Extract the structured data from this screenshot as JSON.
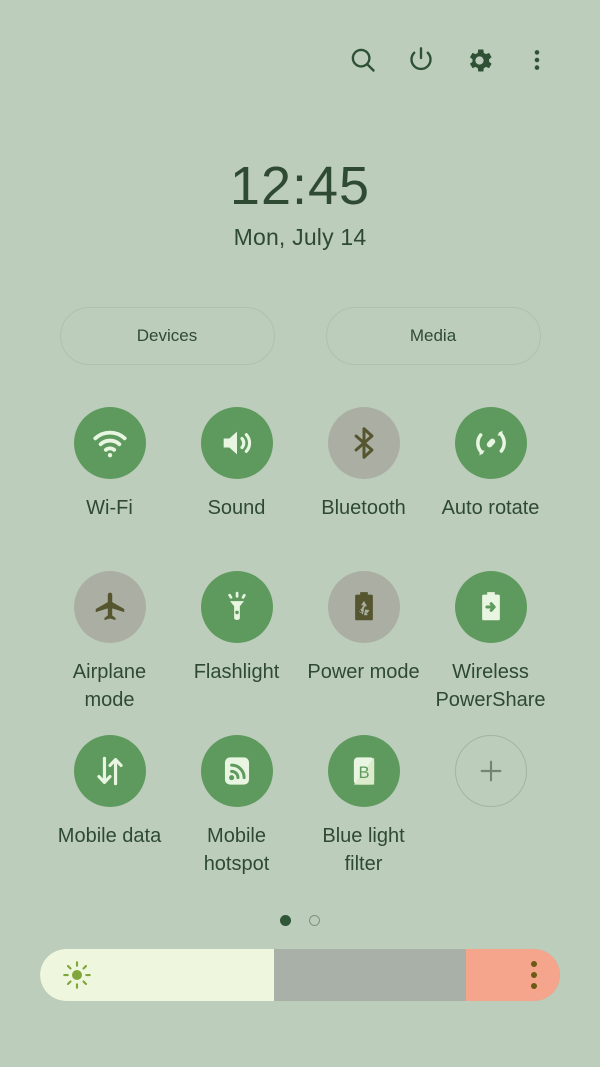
{
  "statusbar": {
    "icons": [
      {
        "name": "search-icon",
        "label": "Search"
      },
      {
        "name": "power-icon",
        "label": "Power off"
      },
      {
        "name": "gear-icon",
        "label": "Settings"
      },
      {
        "name": "more-options-icon",
        "label": "More options"
      }
    ]
  },
  "clock": {
    "time": "12:45",
    "date": "Mon, July 14"
  },
  "chips": [
    {
      "label": "Devices"
    },
    {
      "label": "Media"
    }
  ],
  "toggles": [
    {
      "label": "Wi-Fi",
      "icon": "wifi-icon",
      "state": "on"
    },
    {
      "label": "Sound",
      "icon": "sound-icon",
      "state": "on"
    },
    {
      "label": "Bluetooth",
      "icon": "bluetooth-icon",
      "state": "off"
    },
    {
      "label": "Auto rotate",
      "icon": "auto-rotate-icon",
      "state": "on"
    },
    {
      "label": "Airplane mode",
      "icon": "airplane-icon",
      "state": "off"
    },
    {
      "label": "Flashlight",
      "icon": "flashlight-icon",
      "state": "on"
    },
    {
      "label": "Power mode",
      "icon": "power-mode-icon",
      "state": "off"
    },
    {
      "label": "Wireless PowerShare",
      "icon": "wireless-powershare-icon",
      "state": "on"
    },
    {
      "label": "Mobile data",
      "icon": "mobile-data-icon",
      "state": "on"
    },
    {
      "label": "Mobile hotspot",
      "icon": "mobile-hotspot-icon",
      "state": "on"
    },
    {
      "label": "Blue light filter",
      "icon": "blue-light-filter-icon",
      "state": "on"
    },
    {
      "label": "",
      "icon": "add-icon",
      "state": "add"
    }
  ],
  "pager": {
    "pages": 2,
    "current": 1
  },
  "brightness": {
    "icon": "brightness-sun-icon",
    "value_percent": 45,
    "menu_icon": "brightness-more-icon"
  },
  "colors": {
    "background": "#BDCDBC",
    "accent_on": "#5E9A5E",
    "icon_on": "#E8F5E0",
    "inactive": "#ABAFA3",
    "icon_off": "#55552F",
    "text": "#2E4A33",
    "slider_fill": "#EEF7DD",
    "slider_track": "#A9B0A7",
    "slider_end": "#F5A58C",
    "sun": "#7FA63C"
  }
}
